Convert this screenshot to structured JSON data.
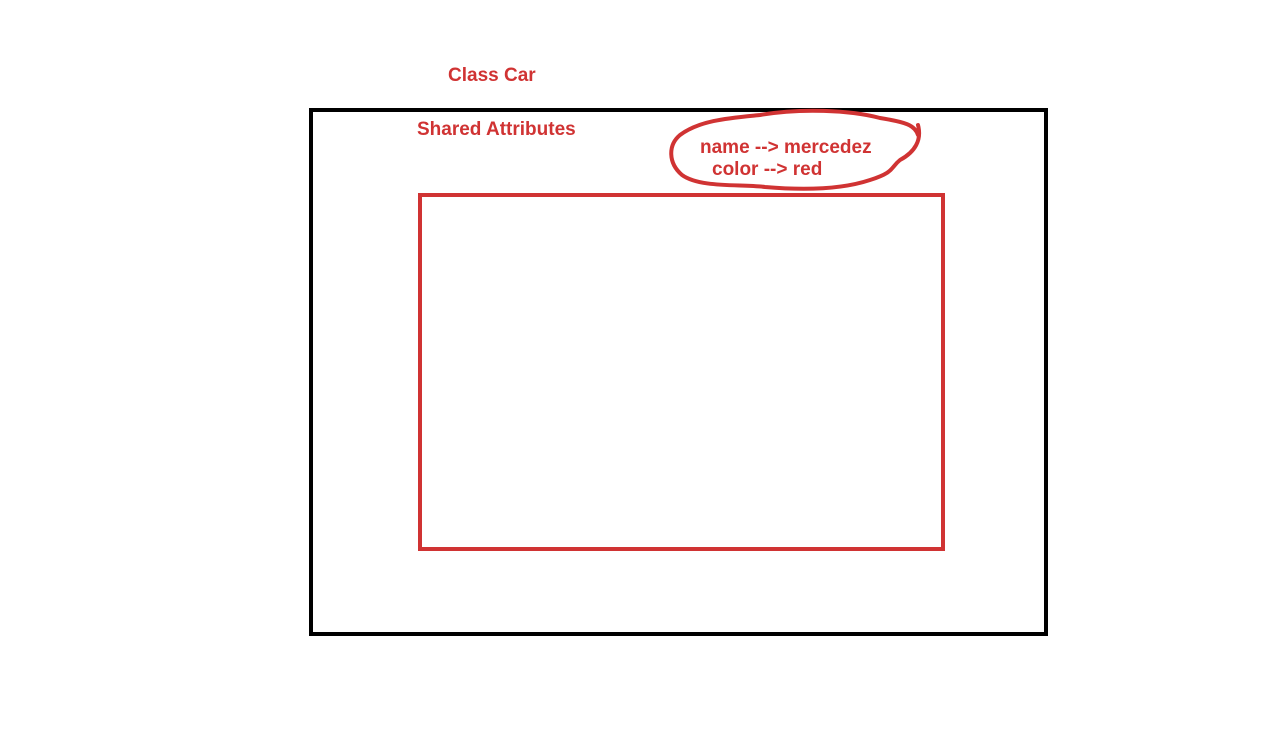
{
  "title": "Class Car",
  "section_label": "Shared Attributes",
  "attributes": [
    "name --> mercedez",
    "color --> red"
  ],
  "colors": {
    "accent": "#d03333",
    "outline": "#000000"
  }
}
